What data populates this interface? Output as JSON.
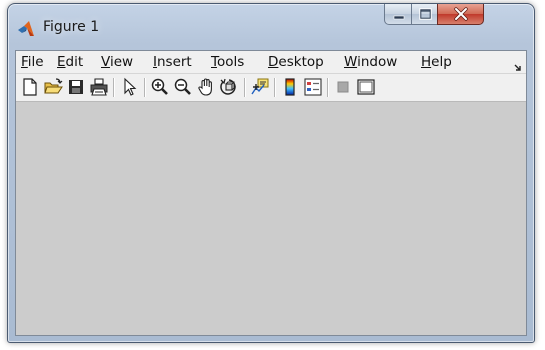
{
  "window": {
    "title": "Figure 1",
    "controls": [
      "minimize-icon",
      "maximize-icon",
      "close-icon"
    ]
  },
  "menubar": {
    "items": [
      {
        "label": "File"
      },
      {
        "label": "Edit"
      },
      {
        "label": "View"
      },
      {
        "label": "Insert"
      },
      {
        "label": "Tools"
      },
      {
        "label": "Desktop"
      },
      {
        "label": "Window"
      },
      {
        "label": "Help"
      }
    ]
  },
  "toolbar": {
    "buttons": [
      "new-figure-icon",
      "open-file-icon",
      "save-figure-icon",
      "print-figure-icon",
      "edit-plot-icon",
      "zoom-in-icon",
      "zoom-out-icon",
      "pan-icon",
      "rotate-3d-icon",
      "data-cursor-icon",
      "colorbar-icon",
      "legend-icon",
      "hide-plot-tools-icon",
      "show-plot-tools-icon"
    ]
  },
  "colors": {
    "figure_background": "#cccccc",
    "menubar_background": "#f0f0f0",
    "close_button": "#c0392b"
  }
}
